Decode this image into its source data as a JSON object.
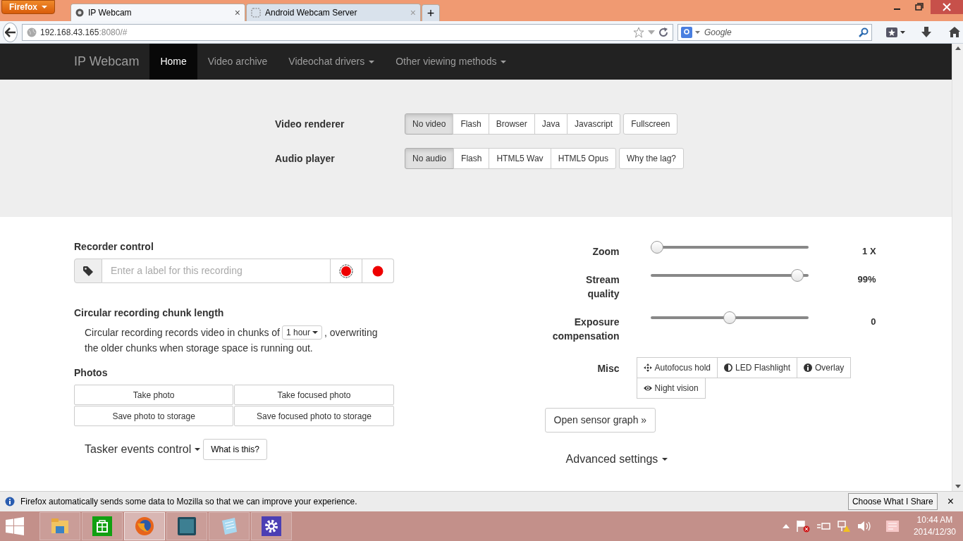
{
  "browser": {
    "menu_button": "Firefox",
    "tabs": [
      {
        "title": "IP Webcam",
        "selected": true,
        "close": "×"
      },
      {
        "title": "Android Webcam Server",
        "selected": false,
        "close": "×"
      }
    ],
    "new_tab": "+",
    "url": {
      "host": "192.168.43.165",
      "rest": ":8080/#"
    },
    "search": {
      "placeholder": "Google"
    }
  },
  "navbar": {
    "brand": "IP Webcam",
    "items": [
      {
        "label": "Home",
        "selected": true,
        "dropdown": false
      },
      {
        "label": "Video archive",
        "selected": false,
        "dropdown": false
      },
      {
        "label": "Videochat drivers",
        "selected": false,
        "dropdown": true
      },
      {
        "label": "Other viewing methods",
        "selected": false,
        "dropdown": true
      }
    ]
  },
  "renderers": [
    {
      "label": "Video renderer",
      "options": [
        {
          "label": "No video",
          "selected": true
        },
        {
          "label": "Flash",
          "selected": false
        },
        {
          "label": "Browser",
          "selected": false
        },
        {
          "label": "Java",
          "selected": false
        },
        {
          "label": "Javascript",
          "selected": false
        }
      ],
      "extra": "Fullscreen"
    },
    {
      "label": "Audio player",
      "options": [
        {
          "label": "No audio",
          "selected": true
        },
        {
          "label": "Flash",
          "selected": false
        },
        {
          "label": "HTML5 Wav",
          "selected": false
        },
        {
          "label": "HTML5 Opus",
          "selected": false
        }
      ],
      "extra": "Why the lag?"
    }
  ],
  "recorder": {
    "title": "Recorder control",
    "placeholder": "Enter a label for this recording"
  },
  "chunk": {
    "title": "Circular recording chunk length",
    "before": "Circular recording records video in chunks of",
    "value": "1 hour",
    "after": ", overwriting",
    "continuation": "the older chunks when storage space is running out."
  },
  "photos": {
    "title": "Photos",
    "buttons": [
      "Take photo",
      "Take focused photo",
      "Save photo to storage",
      "Save focused photo to storage"
    ]
  },
  "tasker": {
    "label": "Tasker events control",
    "help": "What is this?"
  },
  "sliders": [
    {
      "label": "Zoom",
      "level": 0,
      "reading": "1 X"
    },
    {
      "label": "Stream quality",
      "level": 0.97,
      "reading": "99%"
    },
    {
      "label": "Exposure compensation",
      "level": 0.5,
      "reading": "0"
    }
  ],
  "misc": {
    "label": "Misc",
    "buttons": [
      "Autofocus hold",
      "LED Flashlight",
      "Overlay",
      "Night vision"
    ]
  },
  "sensor_graph": "Open sensor graph »",
  "advanced": "Advanced settings",
  "notification": {
    "text": "Firefox automatically sends some data to Mozilla so that we can improve your experience.",
    "button": "Choose What I Share",
    "close": "×"
  },
  "taskbar": {
    "apps": [
      {
        "selected": false
      },
      {
        "selected": false
      },
      {
        "selected": true
      },
      {
        "selected": false
      },
      {
        "selected": false
      },
      {
        "selected": false
      }
    ],
    "time": "10:44 AM",
    "date": "2014/12/30"
  }
}
